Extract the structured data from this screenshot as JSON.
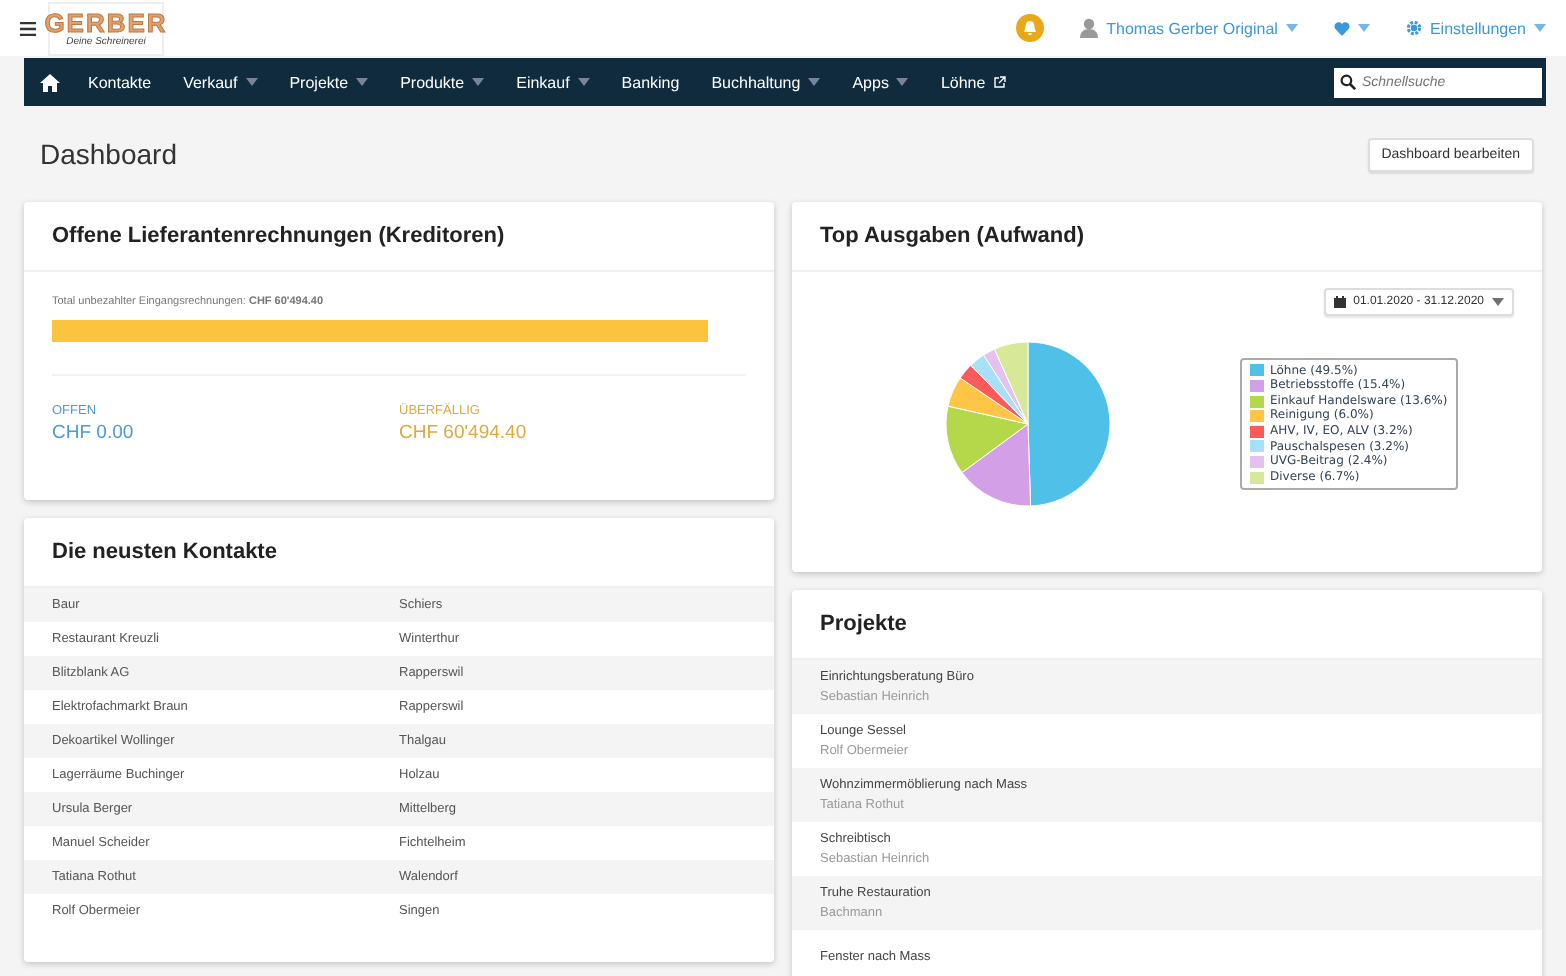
{
  "header": {
    "logo": {
      "name": "GERBER",
      "tagline": "Deine Schreinerei"
    },
    "user": "Thomas Gerber Original",
    "settings": "Einstellungen"
  },
  "nav": {
    "items": [
      {
        "label": "Kontakte",
        "kind": "plain"
      },
      {
        "label": "Verkauf",
        "kind": "dropdown"
      },
      {
        "label": "Projekte",
        "kind": "dropdown"
      },
      {
        "label": "Produkte",
        "kind": "dropdown"
      },
      {
        "label": "Einkauf",
        "kind": "dropdown"
      },
      {
        "label": "Banking",
        "kind": "plain"
      },
      {
        "label": "Buchhaltung",
        "kind": "dropdown"
      },
      {
        "label": "Apps",
        "kind": "dropdown"
      },
      {
        "label": "Löhne",
        "kind": "external"
      }
    ],
    "search": {
      "placeholder": "Schnellsuche"
    }
  },
  "page": {
    "title": "Dashboard",
    "edit_button": "Dashboard bearbeiten"
  },
  "creditors": {
    "title": "Offene Lieferantenrechnungen (Kreditoren)",
    "total": "Total unbezahlter Eingangsrechnungen: **CHF 60'494.40**",
    "level": 1,
    "open": {
      "label": "OFFEN",
      "amount": "CHF 0.00"
    },
    "overdue": {
      "label": "ÜBERFÄLLIG",
      "amount": "CHF 60'494.40"
    }
  },
  "contacts": {
    "title": "Die neusten Kontakte",
    "rows": [
      {
        "name": "Baur",
        "city": "Schiers"
      },
      {
        "name": "Restaurant Kreuzli",
        "city": "Winterthur"
      },
      {
        "name": "Blitzblank AG",
        "city": "Rapperswil"
      },
      {
        "name": "Elektrofachmarkt Braun",
        "city": "Rapperswil"
      },
      {
        "name": "Dekoartikel Wollinger",
        "city": "Thalgau"
      },
      {
        "name": "Lagerräume Buchinger",
        "city": "Holzau"
      },
      {
        "name": "Ursula Berger",
        "city": "Mittelberg"
      },
      {
        "name": "Manuel Scheider",
        "city": "Fichtelheim"
      },
      {
        "name": "Tatiana Rothut",
        "city": "Walendorf"
      },
      {
        "name": "Rolf Obermeier",
        "city": "Singen"
      }
    ]
  },
  "expenses": {
    "title": "Top Ausgaben (Aufwand)",
    "date_range": "01.01.2020 - 31.12.2020",
    "legend": [
      {
        "share": "(49.5%)",
        "color": "#4fc1e9"
      },
      {
        "share": "(15.4%)",
        "color": "#d3a0e8"
      },
      {
        "share": "(13.6%)",
        "color": "#b5d84a"
      },
      {
        "share": "(6.0%)",
        "color": "#ffc547"
      },
      {
        "share": "(3.2%)",
        "color": "#fc5b5b"
      },
      {
        "share": "(3.2%)",
        "color": "#a8e1f7"
      },
      {
        "share": "(2.4%)",
        "color": "#e5c1ef"
      },
      {
        "share": "(6.7%)",
        "color": "#d7e898"
      }
    ],
    "chart_data": {
      "type": "pie",
      "categories": [
        "Löhne",
        "Betriebsstoffe",
        "Einkauf Handelsware",
        "Reinigung",
        "AHV, IV, EO, ALV",
        "Pauschalspesen",
        "UVG-Beitrag",
        "Diverse"
      ],
      "values": [
        49.5,
        15.4,
        13.6,
        6.0,
        3.2,
        3.2,
        2.4,
        6.7
      ]
    }
  },
  "projects": {
    "title": "Projekte",
    "items": [
      {
        "name": "Einrichtungsberatung Büro",
        "client": "Sebastian Heinrich"
      },
      {
        "name": "Lounge Sessel",
        "client": "Rolf Obermeier"
      },
      {
        "name": "Wohnzimmermöblierung nach Mass",
        "client": "Tatiana Rothut"
      },
      {
        "name": "Schreibtisch",
        "client": "Sebastian Heinrich"
      },
      {
        "name": "Truhe Restauration",
        "client": "Bachmann"
      },
      {
        "name": "Fenster nach Mass"
      }
    ]
  }
}
